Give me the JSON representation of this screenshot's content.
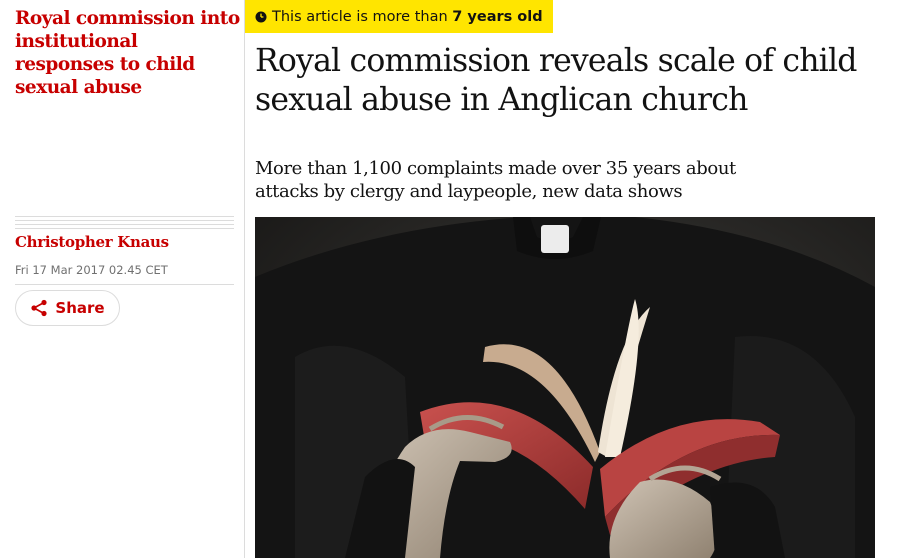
{
  "sidebar": {
    "series_title": "Royal commission into institutional responses to child sexual abuse",
    "author": "Christopher Knaus",
    "published": "Fri 17 Mar 2017 02.45 CET",
    "share_label": "Share",
    "share_icon": "share-icon"
  },
  "article": {
    "age_notice_prefix": "This article is more than",
    "age_notice_value": "7 years old",
    "age_notice_icon": "clock-icon",
    "age_notice_color": "#ffe500",
    "headline": "Royal commission reveals scale of child sexual abuse in Anglican church",
    "standfirst": "More than 1,100 complaints made over 35 years about attacks by clergy and laypeople, new data shows"
  },
  "colors": {
    "accent": "#c70000",
    "text": "#121212",
    "muted": "#707070",
    "rule": "#dcdcdc"
  }
}
